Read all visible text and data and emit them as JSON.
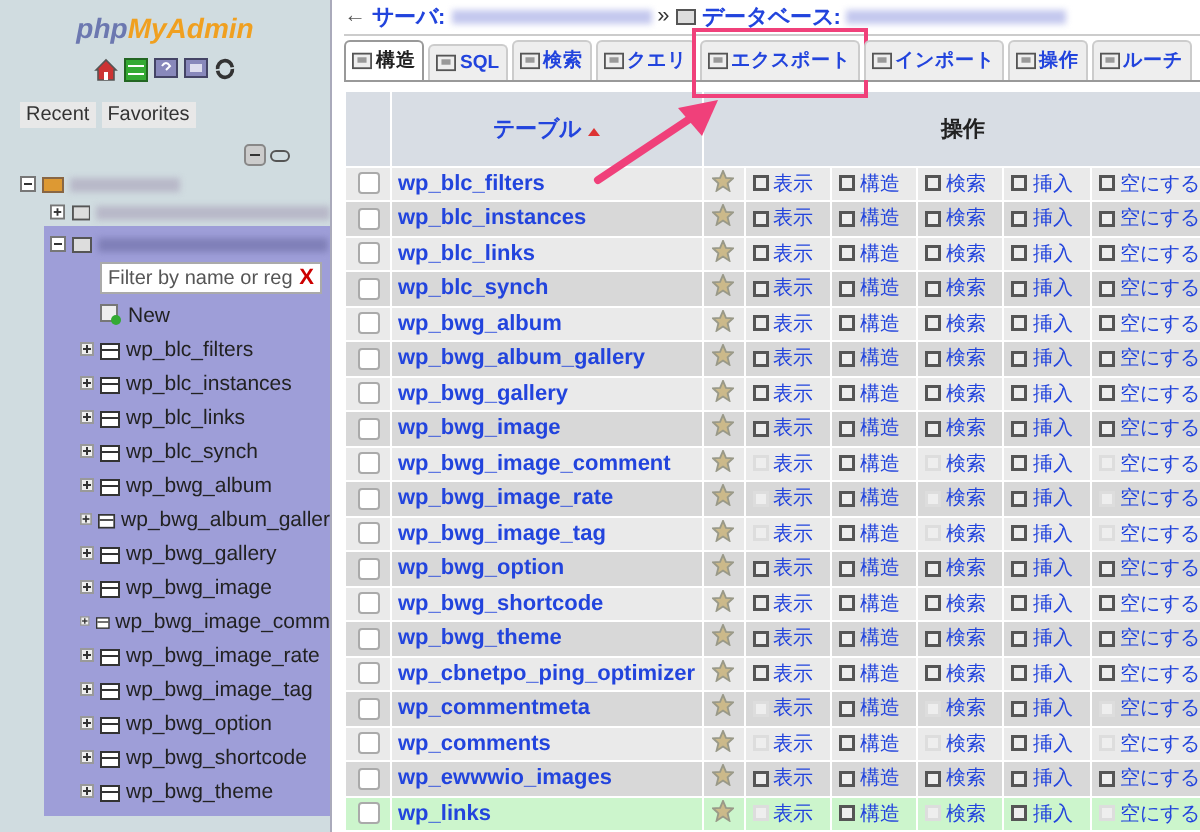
{
  "sidebar": {
    "logo": {
      "part_1": "php",
      "part_2": "MyAdmin"
    },
    "tabs": [
      "Recent",
      "Favorites"
    ],
    "filter": {
      "placeholder": "Filter by name or reg",
      "clear": "X"
    },
    "new_item": "New",
    "tables": [
      "wp_blc_filters",
      "wp_blc_instances",
      "wp_blc_links",
      "wp_blc_synch",
      "wp_bwg_album",
      "wp_bwg_album_galler",
      "wp_bwg_gallery",
      "wp_bwg_image",
      "wp_bwg_image_comm",
      "wp_bwg_image_rate",
      "wp_bwg_image_tag",
      "wp_bwg_option",
      "wp_bwg_shortcode",
      "wp_bwg_theme"
    ]
  },
  "breadcrumb": {
    "back": "←",
    "server_label": "サーバ:",
    "separator": "»",
    "database_label": "データベース:"
  },
  "tabs": [
    {
      "label": "構造",
      "selected": true,
      "annotated": false
    },
    {
      "label": "SQL",
      "selected": false,
      "annotated": false
    },
    {
      "label": "検索",
      "selected": false,
      "annotated": false
    },
    {
      "label": "クエリ",
      "selected": false,
      "annotated": false
    },
    {
      "label": "エクスポート",
      "selected": false,
      "annotated": true
    },
    {
      "label": "インポート",
      "selected": false,
      "annotated": false
    },
    {
      "label": "操作",
      "selected": false,
      "annotated": false
    },
    {
      "label": "ルーチ",
      "selected": false,
      "annotated": false
    }
  ],
  "table": {
    "columns": {
      "name": "テーブル",
      "actions": "操作"
    },
    "rows": [
      {
        "name": "wp_blc_filters",
        "empty": false,
        "highlighted": false,
        "actions": [
          "表示",
          "構造",
          "検索",
          "挿入",
          "空にする"
        ]
      },
      {
        "name": "wp_blc_instances",
        "empty": false,
        "highlighted": false,
        "actions": [
          "表示",
          "構造",
          "検索",
          "挿入",
          "空にする"
        ]
      },
      {
        "name": "wp_blc_links",
        "empty": false,
        "highlighted": false,
        "actions": [
          "表示",
          "構造",
          "検索",
          "挿入",
          "空にする"
        ]
      },
      {
        "name": "wp_blc_synch",
        "empty": false,
        "highlighted": false,
        "actions": [
          "表示",
          "構造",
          "検索",
          "挿入",
          "空にする"
        ]
      },
      {
        "name": "wp_bwg_album",
        "empty": false,
        "highlighted": false,
        "actions": [
          "表示",
          "構造",
          "検索",
          "挿入",
          "空にする"
        ]
      },
      {
        "name": "wp_bwg_album_gallery",
        "empty": false,
        "highlighted": false,
        "actions": [
          "表示",
          "構造",
          "検索",
          "挿入",
          "空にする"
        ]
      },
      {
        "name": "wp_bwg_gallery",
        "empty": false,
        "highlighted": false,
        "actions": [
          "表示",
          "構造",
          "検索",
          "挿入",
          "空にする"
        ]
      },
      {
        "name": "wp_bwg_image",
        "empty": false,
        "highlighted": false,
        "actions": [
          "表示",
          "構造",
          "検索",
          "挿入",
          "空にする"
        ]
      },
      {
        "name": "wp_bwg_image_comment",
        "empty": true,
        "highlighted": false,
        "actions": [
          "表示",
          "構造",
          "検索",
          "挿入",
          "空にする"
        ]
      },
      {
        "name": "wp_bwg_image_rate",
        "empty": true,
        "highlighted": false,
        "actions": [
          "表示",
          "構造",
          "検索",
          "挿入",
          "空にする"
        ]
      },
      {
        "name": "wp_bwg_image_tag",
        "empty": true,
        "highlighted": false,
        "actions": [
          "表示",
          "構造",
          "検索",
          "挿入",
          "空にする"
        ]
      },
      {
        "name": "wp_bwg_option",
        "empty": false,
        "highlighted": false,
        "actions": [
          "表示",
          "構造",
          "検索",
          "挿入",
          "空にする"
        ]
      },
      {
        "name": "wp_bwg_shortcode",
        "empty": false,
        "highlighted": false,
        "actions": [
          "表示",
          "構造",
          "検索",
          "挿入",
          "空にする"
        ]
      },
      {
        "name": "wp_bwg_theme",
        "empty": false,
        "highlighted": false,
        "actions": [
          "表示",
          "構造",
          "検索",
          "挿入",
          "空にする"
        ]
      },
      {
        "name": "wp_cbnetpo_ping_optimizer",
        "empty": false,
        "highlighted": false,
        "actions": [
          "表示",
          "構造",
          "検索",
          "挿入",
          "空にする"
        ]
      },
      {
        "name": "wp_commentmeta",
        "empty": true,
        "highlighted": false,
        "actions": [
          "表示",
          "構造",
          "検索",
          "挿入",
          "空にする"
        ]
      },
      {
        "name": "wp_comments",
        "empty": true,
        "highlighted": false,
        "actions": [
          "表示",
          "構造",
          "検索",
          "挿入",
          "空にする"
        ]
      },
      {
        "name": "wp_ewwwio_images",
        "empty": false,
        "highlighted": false,
        "actions": [
          "表示",
          "構造",
          "検索",
          "挿入",
          "空にする"
        ]
      },
      {
        "name": "wp_links",
        "empty": true,
        "highlighted": true,
        "actions": [
          "表示",
          "構造",
          "検索",
          "挿入",
          "空にする"
        ]
      }
    ]
  }
}
